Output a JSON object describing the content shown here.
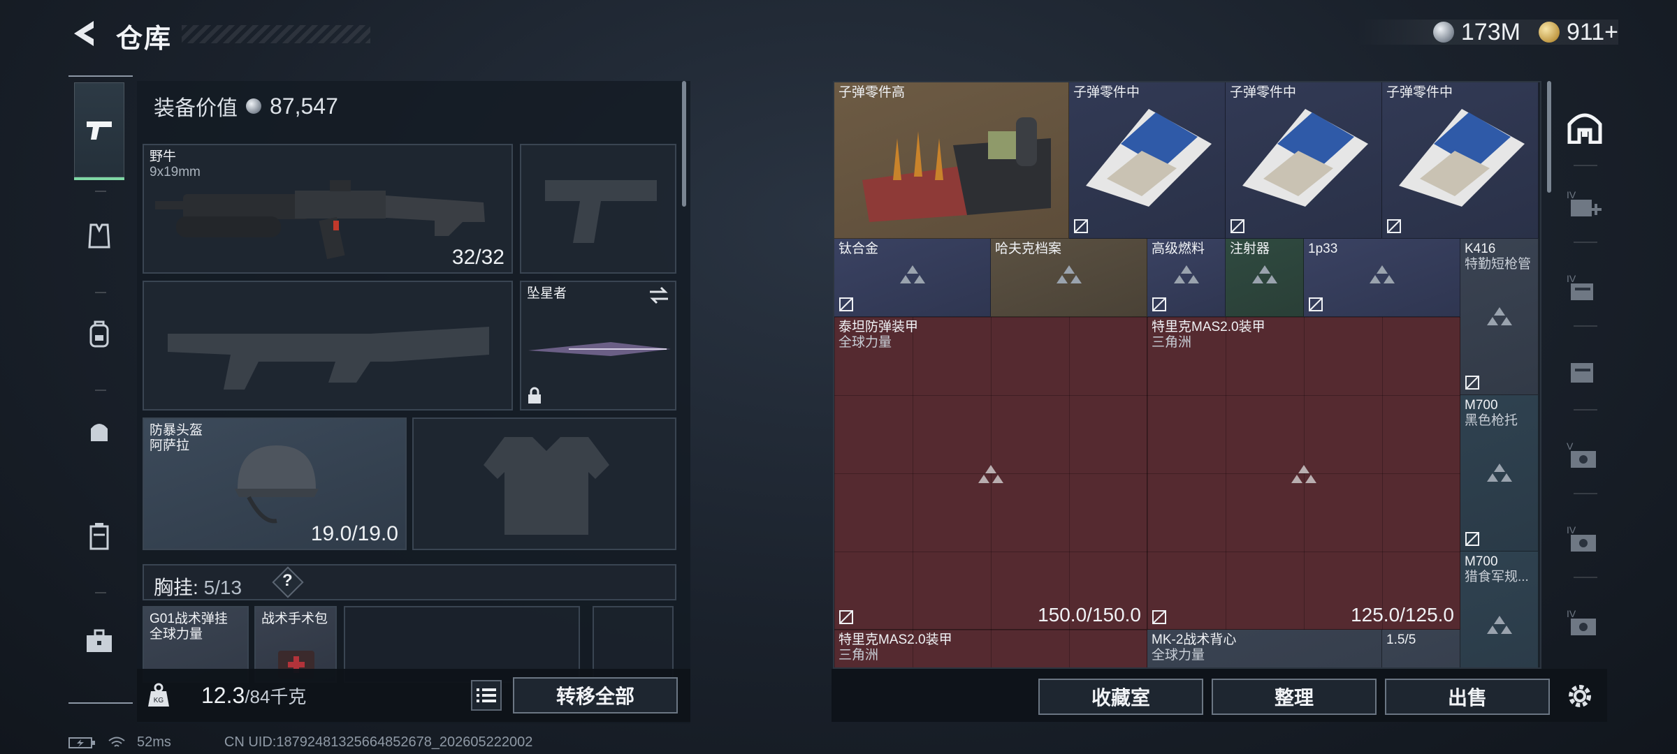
{
  "header": {
    "title": "仓库",
    "currencies": [
      {
        "icon": "silver-coin-icon",
        "value": "173M"
      },
      {
        "icon": "gold-coin-icon",
        "value": "911+"
      }
    ]
  },
  "left_tabs": [
    {
      "name": "firearms",
      "icon": "pistol-icon",
      "active": true
    },
    {
      "name": "vest",
      "icon": "vest-icon",
      "active": false
    },
    {
      "name": "backpack",
      "icon": "backpack-icon",
      "active": false
    },
    {
      "name": "bag",
      "icon": "bag-icon",
      "active": false
    },
    {
      "name": "container",
      "icon": "container-icon",
      "active": false
    },
    {
      "name": "case",
      "icon": "briefcase-icon",
      "active": false
    }
  ],
  "loadout": {
    "equip_value_label": "装备价值",
    "equip_value": "87,547",
    "primary_weapon": {
      "name": "野牛",
      "caliber": "9x19mm",
      "ammo": "32/32"
    },
    "melee": {
      "name": "坠星者"
    },
    "helmet": {
      "name": "防暴头盔",
      "brand": "阿萨拉",
      "durability": "19.0/19.0"
    },
    "chest_rig": {
      "label": "胸挂:",
      "count": "5/13",
      "help": "?"
    },
    "rig_items": [
      {
        "name": "G01战术弹挂",
        "brand": "全球力量"
      },
      {
        "name": "战术手术包",
        "brand": ""
      }
    ]
  },
  "footer_left": {
    "weight": "12.3",
    "weight_max": "/84千克",
    "transfer_all": "转移全部"
  },
  "status": {
    "ping": "52ms",
    "uid": "CN UID:18792481325664852678_202605222002"
  },
  "stash_items": [
    {
      "name": "子弹零件高",
      "sub": ""
    },
    {
      "name": "子弹零件中",
      "sub": ""
    },
    {
      "name": "子弹零件中",
      "sub": ""
    },
    {
      "name": "子弹零件中",
      "sub": ""
    },
    {
      "name": "钛合金",
      "sub": ""
    },
    {
      "name": "哈夫克档案",
      "sub": ""
    },
    {
      "name": "高级燃料",
      "sub": ""
    },
    {
      "name": "注射器",
      "sub": ""
    },
    {
      "name": "1p33",
      "sub": ""
    },
    {
      "name": "K416",
      "sub": "特勤短枪管"
    },
    {
      "name": "泰坦防弹装甲",
      "sub": "全球力量",
      "durability": ""
    },
    {
      "name": "特里克MAS2.0装甲",
      "sub": "三角洲",
      "durability": "150.0/150.0"
    },
    {
      "name": "M700",
      "sub": "黑色枪托"
    },
    {
      "name": "M700",
      "sub": "猎食军规..."
    },
    {
      "name": "特里克MAS2.0装甲",
      "sub": "三角洲"
    },
    {
      "name": "MK-2战术背心",
      "sub": "全球力量"
    },
    {
      "name": "1.5/5",
      "sub": ""
    }
  ],
  "durability_right": "125.0/125.0",
  "footer_right": {
    "collection": "收藏室",
    "sort": "整理",
    "sell": "出售"
  }
}
